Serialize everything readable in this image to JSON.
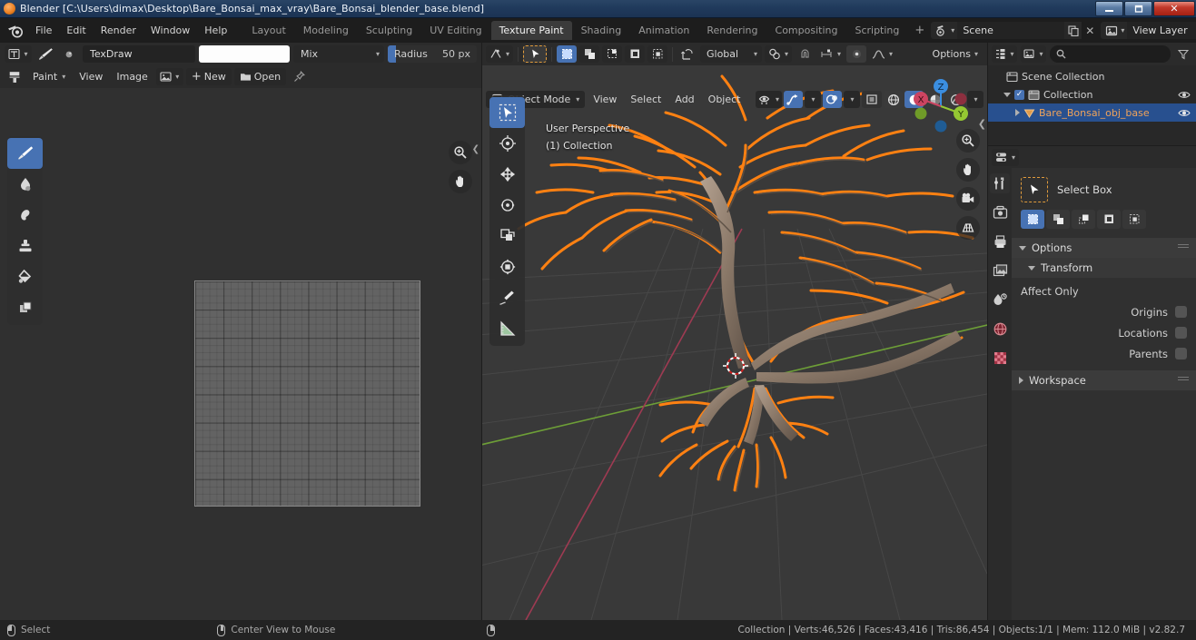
{
  "window": {
    "title": "Blender [C:\\Users\\dimax\\Desktop\\Bare_Bonsai_max_vray\\Bare_Bonsai_blender_base.blend]",
    "minimize_label": "–",
    "restore_label": "❐",
    "close_label": "✕"
  },
  "topbar": {
    "menus": [
      "File",
      "Edit",
      "Render",
      "Window",
      "Help"
    ],
    "workspaces": [
      {
        "label": "Layout",
        "active": false
      },
      {
        "label": "Modeling",
        "active": false
      },
      {
        "label": "Sculpting",
        "active": false
      },
      {
        "label": "UV Editing",
        "active": false
      },
      {
        "label": "Texture Paint",
        "active": true
      },
      {
        "label": "Shading",
        "active": false
      },
      {
        "label": "Animation",
        "active": false
      },
      {
        "label": "Rendering",
        "active": false
      },
      {
        "label": "Compositing",
        "active": false
      },
      {
        "label": "Scripting",
        "active": false
      }
    ],
    "add_workspace_label": "+",
    "scene": {
      "name": "Scene",
      "copy_label": "copy",
      "unlink_label": "✕"
    },
    "view_layer": {
      "name": "View Layer",
      "copy_label": "copy",
      "unlink_label": "✕"
    }
  },
  "image_editor": {
    "editor_type": "image-editor",
    "mode_label": "Paint",
    "brush_name": "TexDraw",
    "color_value": "#ffffff",
    "blend_mode": "Mix",
    "radius_label": "Radius",
    "radius_value": "50 px",
    "menus": [
      "View",
      "Image"
    ],
    "new_label": "New",
    "open_label": "Open",
    "add_label": "+",
    "tools": [
      {
        "name": "draw",
        "active": true
      },
      {
        "name": "soften",
        "active": false
      },
      {
        "name": "smear",
        "active": false
      },
      {
        "name": "clone",
        "active": false
      },
      {
        "name": "fill",
        "active": false
      },
      {
        "name": "mask",
        "active": false
      }
    ],
    "gizmos": [
      "zoom-gizmo",
      "pan-gizmo"
    ]
  },
  "viewport3d": {
    "transform_orientation": "Global",
    "options_label": "Options",
    "mode": "Object Mode",
    "menus": [
      "View",
      "Select",
      "Add",
      "Object"
    ],
    "overlay_text_line1": "User Perspective",
    "overlay_text_line2": "(1) Collection",
    "gizmo_axes": [
      {
        "label": "X",
        "color": "#cc4461"
      },
      {
        "label": "Y",
        "color": "#95c832"
      },
      {
        "label": "Z",
        "color": "#3b8ee0"
      }
    ],
    "nav_gizmos": [
      "zoom-gizmo",
      "pan-gizmo",
      "camera-view-gizmo",
      "ortho-persp-gizmo"
    ],
    "tools": [
      {
        "name": "select-box",
        "active": true
      },
      {
        "name": "cursor",
        "active": false
      },
      {
        "name": "move",
        "active": false
      },
      {
        "name": "rotate",
        "active": false
      },
      {
        "name": "scale",
        "active": false
      },
      {
        "name": "transform",
        "active": false
      },
      {
        "name": "annotate",
        "active": false
      },
      {
        "name": "measure",
        "active": false
      }
    ],
    "shading_modes": [
      "wireframe",
      "solid",
      "material-preview",
      "rendered"
    ],
    "active_shading": "solid"
  },
  "outliner": {
    "display_mode": "View Layer",
    "search_placeholder": "",
    "rows": [
      {
        "label": "Scene Collection",
        "indent": 0,
        "selected": false,
        "expander": "none",
        "checkbox": false,
        "eye": false,
        "icon": "collection-icon"
      },
      {
        "label": "Collection",
        "indent": 1,
        "selected": false,
        "expander": "down",
        "checkbox": true,
        "eye": true,
        "icon": "collection-icon"
      },
      {
        "label": "Bare_Bonsai_obj_base",
        "indent": 2,
        "selected": true,
        "expander": "right",
        "checkbox": false,
        "eye": true,
        "icon": "mesh-icon"
      }
    ]
  },
  "properties": {
    "tabs": [
      {
        "name": "tool",
        "active": true
      },
      {
        "name": "render",
        "active": false
      },
      {
        "name": "output",
        "active": false
      },
      {
        "name": "view-layer",
        "active": false
      },
      {
        "name": "scene",
        "active": false
      },
      {
        "name": "world",
        "active": false
      },
      {
        "name": "texture",
        "active": false
      }
    ],
    "active_tool_label": "Select Box",
    "select_modes": [
      {
        "name": "set",
        "active": true
      },
      {
        "name": "extend",
        "active": false
      },
      {
        "name": "subtract",
        "active": false
      },
      {
        "name": "invert",
        "active": false
      },
      {
        "name": "intersect",
        "active": false
      }
    ],
    "options_panel": "Options",
    "transform_panel": "Transform",
    "affect_only_label": "Affect Only",
    "affect_rows": [
      {
        "label": "Origins",
        "checked": false
      },
      {
        "label": "Locations",
        "checked": false
      },
      {
        "label": "Parents",
        "checked": false
      }
    ],
    "workspace_panel": "Workspace"
  },
  "statusbar": {
    "keymap": [
      {
        "button": "left",
        "label": "Select"
      },
      {
        "button": "mid",
        "label": "Center View to Mouse"
      },
      {
        "button": "right",
        "label": ""
      }
    ],
    "scene_stats": "Collection | Verts:46,526 | Faces:43,416 | Tris:86,454 | Objects:1/1 | Mem: 112.0 MiB | v2.82.7"
  },
  "colors": {
    "accent": "#4772b3",
    "selected_outline": "#ff8112",
    "active_object_text": "#f0a35a",
    "header_bg": "#2b2b2b",
    "editor_bg": "#303030",
    "viewport_bg": "#393939"
  }
}
